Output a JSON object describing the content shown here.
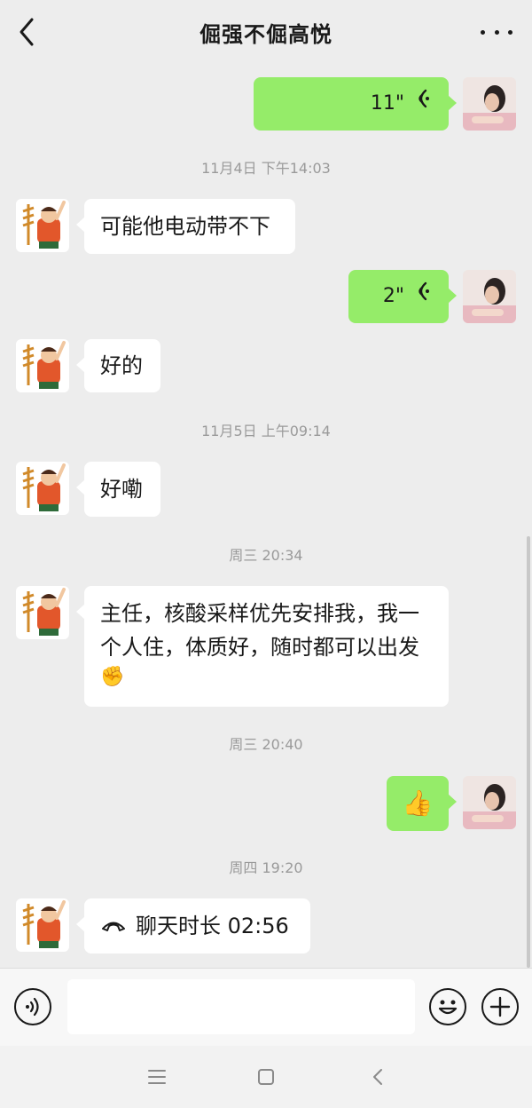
{
  "header": {
    "title": "倔强不倔高悦",
    "back_icon": "chevron-left-icon",
    "more_icon": "more-dots-icon"
  },
  "messages": {
    "voice1": {
      "duration": "11\"",
      "icon": "voice-wave-icon"
    },
    "ts1": "11月4日 下午14:03",
    "text1": "可能他电动带不下",
    "voice2": {
      "duration": "2\"",
      "icon": "voice-wave-icon"
    },
    "text2": "好的",
    "ts2": "11月5日 上午09:14",
    "text3": "好嘞",
    "ts3": "周三 20:34",
    "text4_line1": "主任，核酸采样优先安排我，我一",
    "text4_line2": "个人住，体质好，随时都可以出发",
    "text4_emoji": "✊",
    "ts4": "周三 20:40",
    "thumbs_emoji": "👍",
    "ts5": "周四 19:20",
    "call": {
      "icon": "phone-hangup-icon",
      "label": "聊天时长 02:56"
    }
  },
  "inputbar": {
    "voice_icon": "voice-input-icon",
    "input_value": "",
    "emoji_icon": "emoji-icon",
    "plus_icon": "plus-icon"
  },
  "sysnav": {
    "menu_icon": "menu-icon",
    "home_icon": "home-square-icon",
    "back_icon": "back-arrow-icon"
  },
  "colors": {
    "background": "#ededed",
    "bubble_self": "#95ec69",
    "bubble_other": "#ffffff",
    "timestamp": "#9a9a9a"
  }
}
